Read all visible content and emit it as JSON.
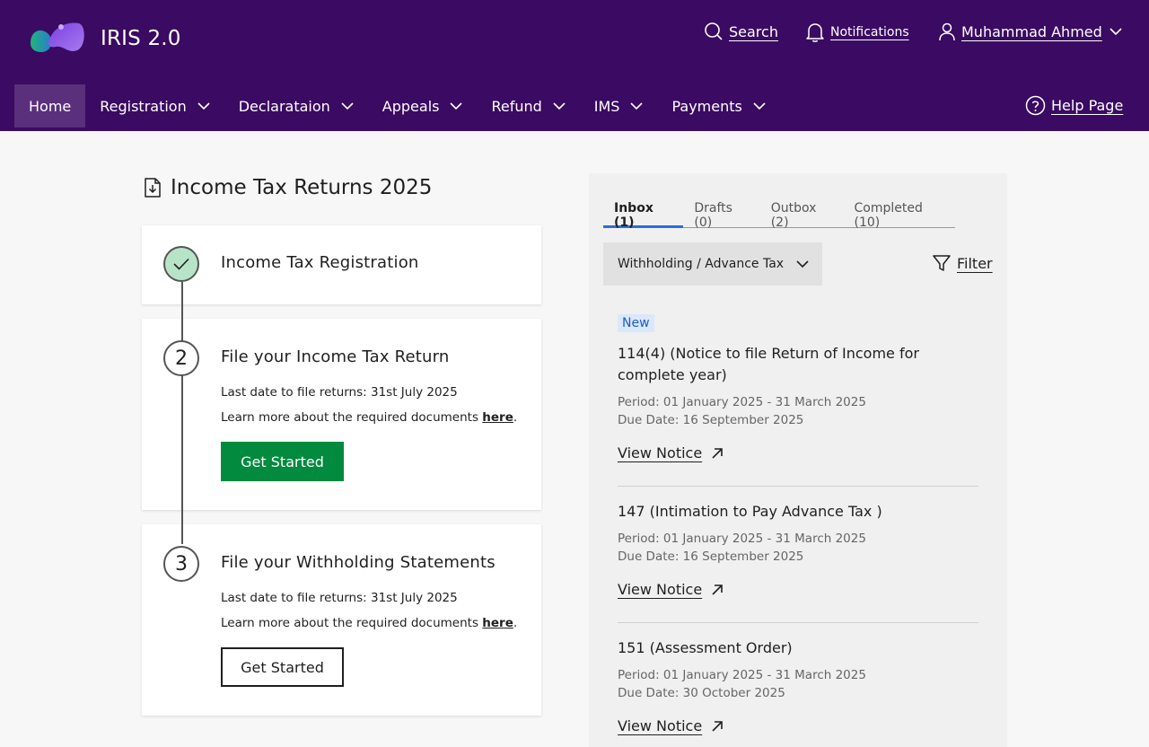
{
  "header": {
    "app_title": "IRIS 2.0",
    "search_label": "Search",
    "notifications_label": "Notifications",
    "user_name": "Muhammad Ahmed",
    "help_label": "Help Page"
  },
  "nav": {
    "items": [
      {
        "label": "Home",
        "active": true
      },
      {
        "label": "Registration"
      },
      {
        "label": "Declarataion"
      },
      {
        "label": "Appeals"
      },
      {
        "label": "Refund"
      },
      {
        "label": "IMS"
      },
      {
        "label": "Payments"
      }
    ]
  },
  "left": {
    "section_title": "Income Tax Returns 2025",
    "steps": [
      {
        "title": "Income Tax Registration",
        "status": "done"
      },
      {
        "number": "2",
        "title": "File your Income Tax Return",
        "deadline": "Last date to file returns: 31st July 2025",
        "learn_prefix": "Learn more about the required documents ",
        "learn_link": "here",
        "learn_suffix": ".",
        "button": "Get Started"
      },
      {
        "number": "3",
        "title": "File your Withholding Statements",
        "deadline": "Last date to file returns: 31st July 2025",
        "learn_prefix": "Learn more about the required documents ",
        "learn_link": "here",
        "learn_suffix": ".",
        "button": "Get Started"
      }
    ]
  },
  "right": {
    "tabs": [
      {
        "label": "Inbox (1)",
        "active": true
      },
      {
        "label": "Drafts (0)"
      },
      {
        "label": "Outbox (2)"
      },
      {
        "label": "Completed (10)"
      }
    ],
    "dropdown_value": "Withholding / Advance Tax",
    "filter_label": "Filter",
    "badge_new": "New",
    "notices": [
      {
        "title": "114(4) (Notice to file Return of Income for complete year)",
        "period": "Period: 01 January 2025 - 31 March 2025",
        "due": "Due Date: 16 September 2025",
        "link": "View Notice"
      },
      {
        "title": "147 (Intimation to Pay Advance Tax )",
        "period": "Period: 01 January 2025 - 31 March 2025",
        "due": "Due Date: 16 September 2025",
        "link": "View Notice"
      },
      {
        "title": "151 (Assessment Order)",
        "period": "Period: 01 January 2025 - 31 March 2025",
        "due": "Due Date: 30 October 2025",
        "link": "View Notice"
      }
    ]
  },
  "colors": {
    "header_bg": "#3b0a62",
    "nav_active_bg": "#5a2f7c",
    "primary_button": "#028a3e",
    "tab_active_underline": "#2a6fdb",
    "step_done": "#b7e4c7"
  },
  "icons": [
    "logo",
    "search-icon",
    "bell-icon",
    "user-icon",
    "chevron-down-icon",
    "help-circle-icon",
    "document-download-icon",
    "check-icon",
    "filter-icon",
    "arrow-up-right-icon"
  ]
}
